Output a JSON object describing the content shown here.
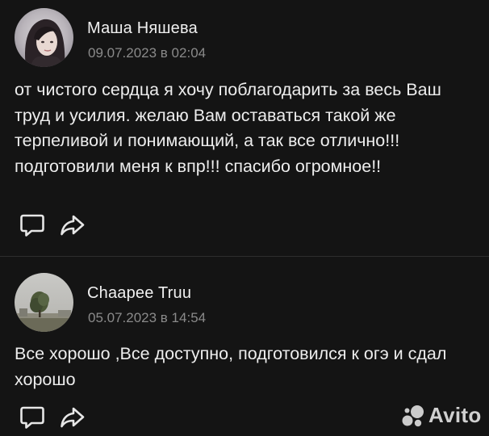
{
  "reviews": [
    {
      "author": "Маша Няшева",
      "date": "09.07.2023 в 02:04",
      "text": "от чистого сердца я хочу поблагодарить за весь Ваш труд и усилия. желаю Вам оставаться такой же терпеливой и понимающий, а так все отлично!!!подготовили меня к впр!!! спасибо огромное!!"
    },
    {
      "author": "Chaapee Truu",
      "date": "05.07.2023 в 14:54",
      "text": "Все хорошо ,Все доступно, подготовился к огэ и сдал хорошо"
    }
  ],
  "icons": {
    "comment": "comment-icon",
    "share": "share-icon"
  },
  "watermark": {
    "text": "Avito"
  },
  "colors": {
    "background": "#141414",
    "date": "#8a8a8a",
    "text": "#ededed"
  }
}
